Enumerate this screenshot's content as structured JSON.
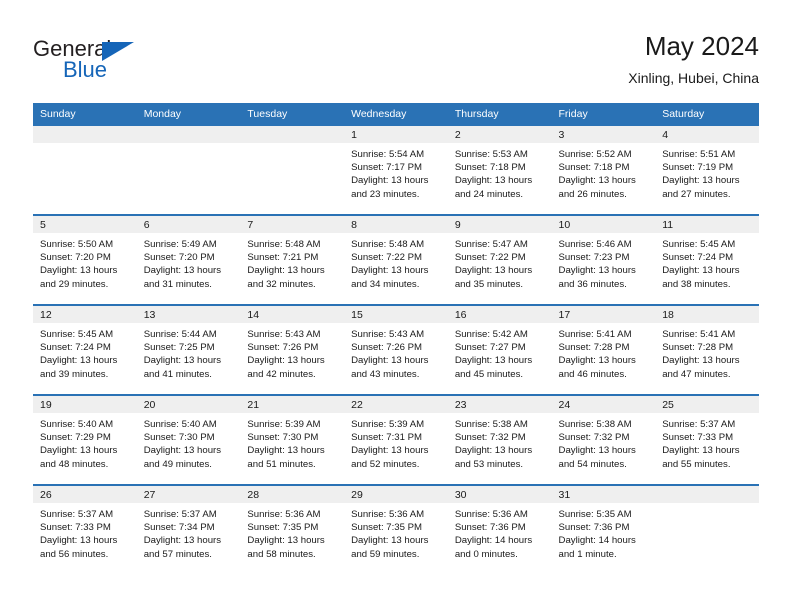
{
  "brand": {
    "word_one": "General",
    "word_two": "Blue",
    "triangle_color": "#1565b8",
    "text_color": "#231f20"
  },
  "header": {
    "title": "May 2024",
    "subtitle": "Xinling, Hubei, China"
  },
  "theme": {
    "header_bg": "#2a72b5",
    "header_text": "#ffffff",
    "daynum_band_bg": "#efefef",
    "row_divider": "#2a72b5",
    "body_text": "#1a1a1a"
  },
  "weekday_headers": [
    "Sunday",
    "Monday",
    "Tuesday",
    "Wednesday",
    "Thursday",
    "Friday",
    "Saturday"
  ],
  "labels": {
    "sunrise_prefix": "Sunrise:",
    "sunset_prefix": "Sunset:",
    "daylight_prefix": "Daylight:"
  },
  "weeks": [
    [
      {
        "empty": true
      },
      {
        "empty": true
      },
      {
        "empty": true
      },
      {
        "day": "1",
        "sunrise": "Sunrise: 5:54 AM",
        "sunset": "Sunset: 7:17 PM",
        "daylight_line1": "Daylight: 13 hours",
        "daylight_line2": "and 23 minutes."
      },
      {
        "day": "2",
        "sunrise": "Sunrise: 5:53 AM",
        "sunset": "Sunset: 7:18 PM",
        "daylight_line1": "Daylight: 13 hours",
        "daylight_line2": "and 24 minutes."
      },
      {
        "day": "3",
        "sunrise": "Sunrise: 5:52 AM",
        "sunset": "Sunset: 7:18 PM",
        "daylight_line1": "Daylight: 13 hours",
        "daylight_line2": "and 26 minutes."
      },
      {
        "day": "4",
        "sunrise": "Sunrise: 5:51 AM",
        "sunset": "Sunset: 7:19 PM",
        "daylight_line1": "Daylight: 13 hours",
        "daylight_line2": "and 27 minutes."
      }
    ],
    [
      {
        "day": "5",
        "sunrise": "Sunrise: 5:50 AM",
        "sunset": "Sunset: 7:20 PM",
        "daylight_line1": "Daylight: 13 hours",
        "daylight_line2": "and 29 minutes."
      },
      {
        "day": "6",
        "sunrise": "Sunrise: 5:49 AM",
        "sunset": "Sunset: 7:20 PM",
        "daylight_line1": "Daylight: 13 hours",
        "daylight_line2": "and 31 minutes."
      },
      {
        "day": "7",
        "sunrise": "Sunrise: 5:48 AM",
        "sunset": "Sunset: 7:21 PM",
        "daylight_line1": "Daylight: 13 hours",
        "daylight_line2": "and 32 minutes."
      },
      {
        "day": "8",
        "sunrise": "Sunrise: 5:48 AM",
        "sunset": "Sunset: 7:22 PM",
        "daylight_line1": "Daylight: 13 hours",
        "daylight_line2": "and 34 minutes."
      },
      {
        "day": "9",
        "sunrise": "Sunrise: 5:47 AM",
        "sunset": "Sunset: 7:22 PM",
        "daylight_line1": "Daylight: 13 hours",
        "daylight_line2": "and 35 minutes."
      },
      {
        "day": "10",
        "sunrise": "Sunrise: 5:46 AM",
        "sunset": "Sunset: 7:23 PM",
        "daylight_line1": "Daylight: 13 hours",
        "daylight_line2": "and 36 minutes."
      },
      {
        "day": "11",
        "sunrise": "Sunrise: 5:45 AM",
        "sunset": "Sunset: 7:24 PM",
        "daylight_line1": "Daylight: 13 hours",
        "daylight_line2": "and 38 minutes."
      }
    ],
    [
      {
        "day": "12",
        "sunrise": "Sunrise: 5:45 AM",
        "sunset": "Sunset: 7:24 PM",
        "daylight_line1": "Daylight: 13 hours",
        "daylight_line2": "and 39 minutes."
      },
      {
        "day": "13",
        "sunrise": "Sunrise: 5:44 AM",
        "sunset": "Sunset: 7:25 PM",
        "daylight_line1": "Daylight: 13 hours",
        "daylight_line2": "and 41 minutes."
      },
      {
        "day": "14",
        "sunrise": "Sunrise: 5:43 AM",
        "sunset": "Sunset: 7:26 PM",
        "daylight_line1": "Daylight: 13 hours",
        "daylight_line2": "and 42 minutes."
      },
      {
        "day": "15",
        "sunrise": "Sunrise: 5:43 AM",
        "sunset": "Sunset: 7:26 PM",
        "daylight_line1": "Daylight: 13 hours",
        "daylight_line2": "and 43 minutes."
      },
      {
        "day": "16",
        "sunrise": "Sunrise: 5:42 AM",
        "sunset": "Sunset: 7:27 PM",
        "daylight_line1": "Daylight: 13 hours",
        "daylight_line2": "and 45 minutes."
      },
      {
        "day": "17",
        "sunrise": "Sunrise: 5:41 AM",
        "sunset": "Sunset: 7:28 PM",
        "daylight_line1": "Daylight: 13 hours",
        "daylight_line2": "and 46 minutes."
      },
      {
        "day": "18",
        "sunrise": "Sunrise: 5:41 AM",
        "sunset": "Sunset: 7:28 PM",
        "daylight_line1": "Daylight: 13 hours",
        "daylight_line2": "and 47 minutes."
      }
    ],
    [
      {
        "day": "19",
        "sunrise": "Sunrise: 5:40 AM",
        "sunset": "Sunset: 7:29 PM",
        "daylight_line1": "Daylight: 13 hours",
        "daylight_line2": "and 48 minutes."
      },
      {
        "day": "20",
        "sunrise": "Sunrise: 5:40 AM",
        "sunset": "Sunset: 7:30 PM",
        "daylight_line1": "Daylight: 13 hours",
        "daylight_line2": "and 49 minutes."
      },
      {
        "day": "21",
        "sunrise": "Sunrise: 5:39 AM",
        "sunset": "Sunset: 7:30 PM",
        "daylight_line1": "Daylight: 13 hours",
        "daylight_line2": "and 51 minutes."
      },
      {
        "day": "22",
        "sunrise": "Sunrise: 5:39 AM",
        "sunset": "Sunset: 7:31 PM",
        "daylight_line1": "Daylight: 13 hours",
        "daylight_line2": "and 52 minutes."
      },
      {
        "day": "23",
        "sunrise": "Sunrise: 5:38 AM",
        "sunset": "Sunset: 7:32 PM",
        "daylight_line1": "Daylight: 13 hours",
        "daylight_line2": "and 53 minutes."
      },
      {
        "day": "24",
        "sunrise": "Sunrise: 5:38 AM",
        "sunset": "Sunset: 7:32 PM",
        "daylight_line1": "Daylight: 13 hours",
        "daylight_line2": "and 54 minutes."
      },
      {
        "day": "25",
        "sunrise": "Sunrise: 5:37 AM",
        "sunset": "Sunset: 7:33 PM",
        "daylight_line1": "Daylight: 13 hours",
        "daylight_line2": "and 55 minutes."
      }
    ],
    [
      {
        "day": "26",
        "sunrise": "Sunrise: 5:37 AM",
        "sunset": "Sunset: 7:33 PM",
        "daylight_line1": "Daylight: 13 hours",
        "daylight_line2": "and 56 minutes."
      },
      {
        "day": "27",
        "sunrise": "Sunrise: 5:37 AM",
        "sunset": "Sunset: 7:34 PM",
        "daylight_line1": "Daylight: 13 hours",
        "daylight_line2": "and 57 minutes."
      },
      {
        "day": "28",
        "sunrise": "Sunrise: 5:36 AM",
        "sunset": "Sunset: 7:35 PM",
        "daylight_line1": "Daylight: 13 hours",
        "daylight_line2": "and 58 minutes."
      },
      {
        "day": "29",
        "sunrise": "Sunrise: 5:36 AM",
        "sunset": "Sunset: 7:35 PM",
        "daylight_line1": "Daylight: 13 hours",
        "daylight_line2": "and 59 minutes."
      },
      {
        "day": "30",
        "sunrise": "Sunrise: 5:36 AM",
        "sunset": "Sunset: 7:36 PM",
        "daylight_line1": "Daylight: 14 hours",
        "daylight_line2": "and 0 minutes."
      },
      {
        "day": "31",
        "sunrise": "Sunrise: 5:35 AM",
        "sunset": "Sunset: 7:36 PM",
        "daylight_line1": "Daylight: 14 hours",
        "daylight_line2": "and 1 minute."
      },
      {
        "empty": true
      }
    ]
  ]
}
